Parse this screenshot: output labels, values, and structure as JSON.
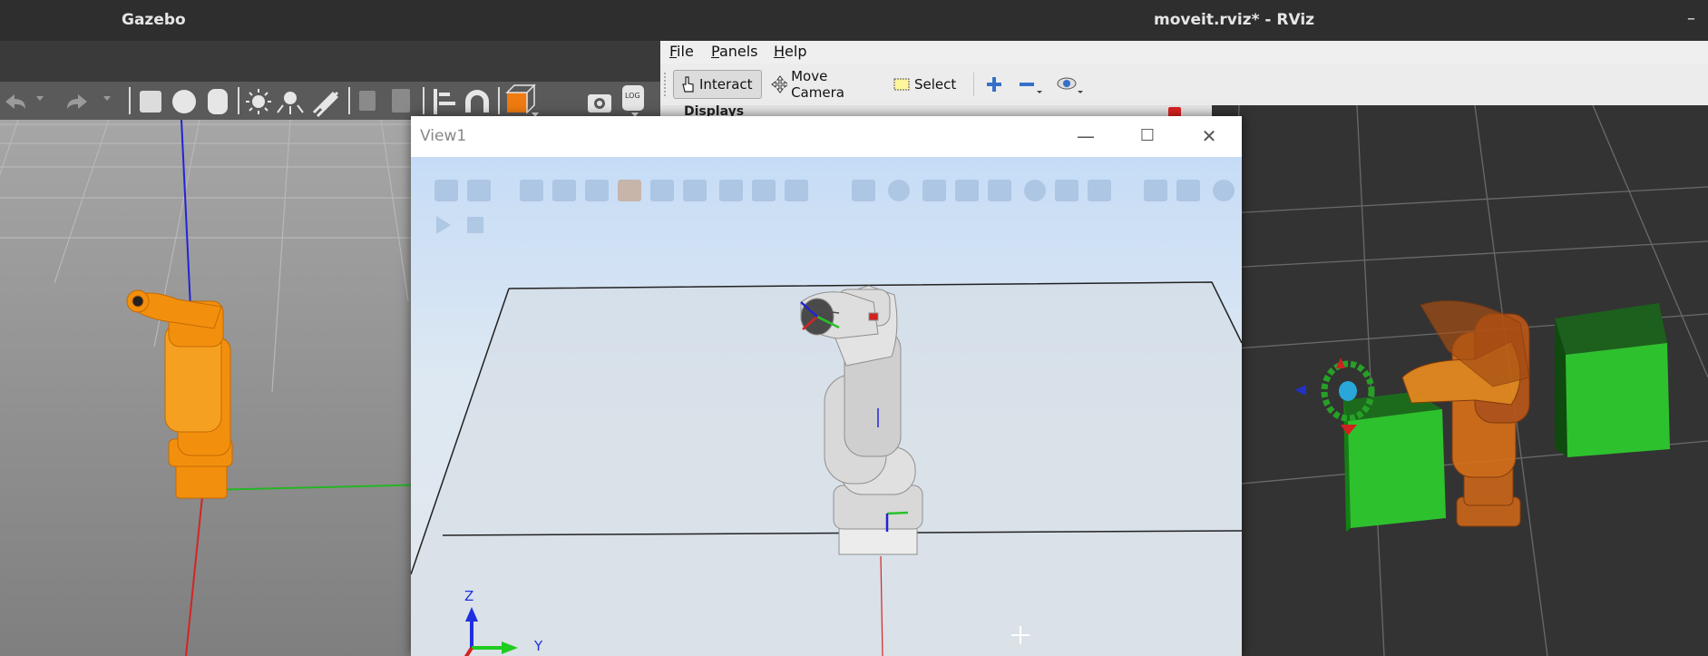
{
  "gazebo": {
    "title": "Gazebo",
    "toolbar_icons": [
      "undo-icon",
      "undo-dropdown-icon",
      "redo-icon",
      "redo-dropdown-icon",
      "box-shape-icon",
      "sphere-shape-icon",
      "cylinder-shape-icon",
      "point-light-icon",
      "spot-light-icon",
      "directional-light-icon",
      "copy-icon",
      "paste-icon",
      "align-icon",
      "snap-magnet-icon",
      "view-angle-icon",
      "screenshot-icon",
      "log-icon"
    ],
    "colors": {
      "robot": "#f0900f",
      "ground": "#8e8e8e",
      "x_axis": "#d02020",
      "y_axis": "#20b020",
      "z_axis": "#2020d0"
    }
  },
  "rviz": {
    "title": "moveit.rviz* - RViz",
    "window_min": "–",
    "menu": [
      "File",
      "Panels",
      "Help"
    ],
    "menu_mnemonic": [
      "F",
      "P",
      "H"
    ],
    "menu_rest": [
      "ile",
      "anels",
      "elp"
    ],
    "toolbar": {
      "interact": "Interact",
      "move_camera": "Move Camera",
      "select": "Select"
    },
    "displays_label": "Displays",
    "colors": {
      "collision_box": "#2ec12e",
      "robot": "#e07d18",
      "background": "#333333"
    }
  },
  "view1": {
    "title": "View1",
    "axis_labels": {
      "z": "Z",
      "y": "Y"
    },
    "colors": {
      "robot": "#d8d8d8",
      "floor": "#d6dde5"
    }
  }
}
